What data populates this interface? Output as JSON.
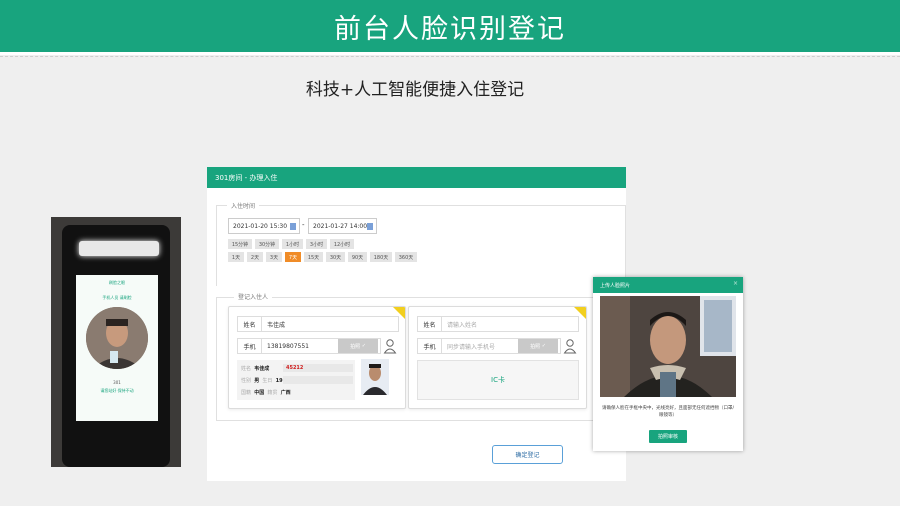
{
  "banner": {
    "title": "前台人脸识别登记"
  },
  "subtitle": "科技+人工智能便捷入住登记",
  "device": {
    "screen_title": "刷脸之眼",
    "hint": "手机人员 请刷脸",
    "room_no": "301",
    "footer": "请您站好 保持不动"
  },
  "window": {
    "title": "301房间 - 办理入住",
    "checkin_legend": "入住时间",
    "start_date": "2021-01-20 15:30",
    "end_date": "2021-01-27 14:00",
    "duration_row1": [
      "15分钟",
      "30分钟",
      "1小时",
      "3小时",
      "12小时"
    ],
    "duration_row2": [
      "1天",
      "2天",
      "3天",
      "7天",
      "15天",
      "30天",
      "90天",
      "180天",
      "360天"
    ],
    "active_duration": "7天",
    "guest_legend": "登记入住人",
    "card1": {
      "name_label": "姓名",
      "name_value": "韦佳成",
      "phone_label": "手机",
      "phone_value": "13819807551",
      "photo_btn": "拍照",
      "info": {
        "name_label": "姓名",
        "name_value": "韦佳成",
        "id_value": "45212",
        "gender_label": "性别",
        "gender_value": "男",
        "birth_label": "生日",
        "birth_value": "19",
        "nation_label": "国籍",
        "nation_value": "中国",
        "place_label": "籍贯",
        "place_value": "广西"
      }
    },
    "card2": {
      "name_label": "姓名",
      "name_placeholder": "请输入姓名",
      "phone_label": "手机",
      "phone_placeholder": "同步请输入手机号",
      "photo_btn": "拍照",
      "ic_label": "IC卡"
    },
    "confirm_button": "确定登记"
  },
  "dialog": {
    "title": "上传人脸照片",
    "close": "×",
    "tip": "请确保人脸在手框中央中，光线亮好，且面部无任何遮挡物（口罩/眼镜等）",
    "button": "拍照审核"
  },
  "colors": {
    "brand": "#18a47e",
    "active_chip": "#f08c28",
    "corner": "#f2cf1e"
  }
}
